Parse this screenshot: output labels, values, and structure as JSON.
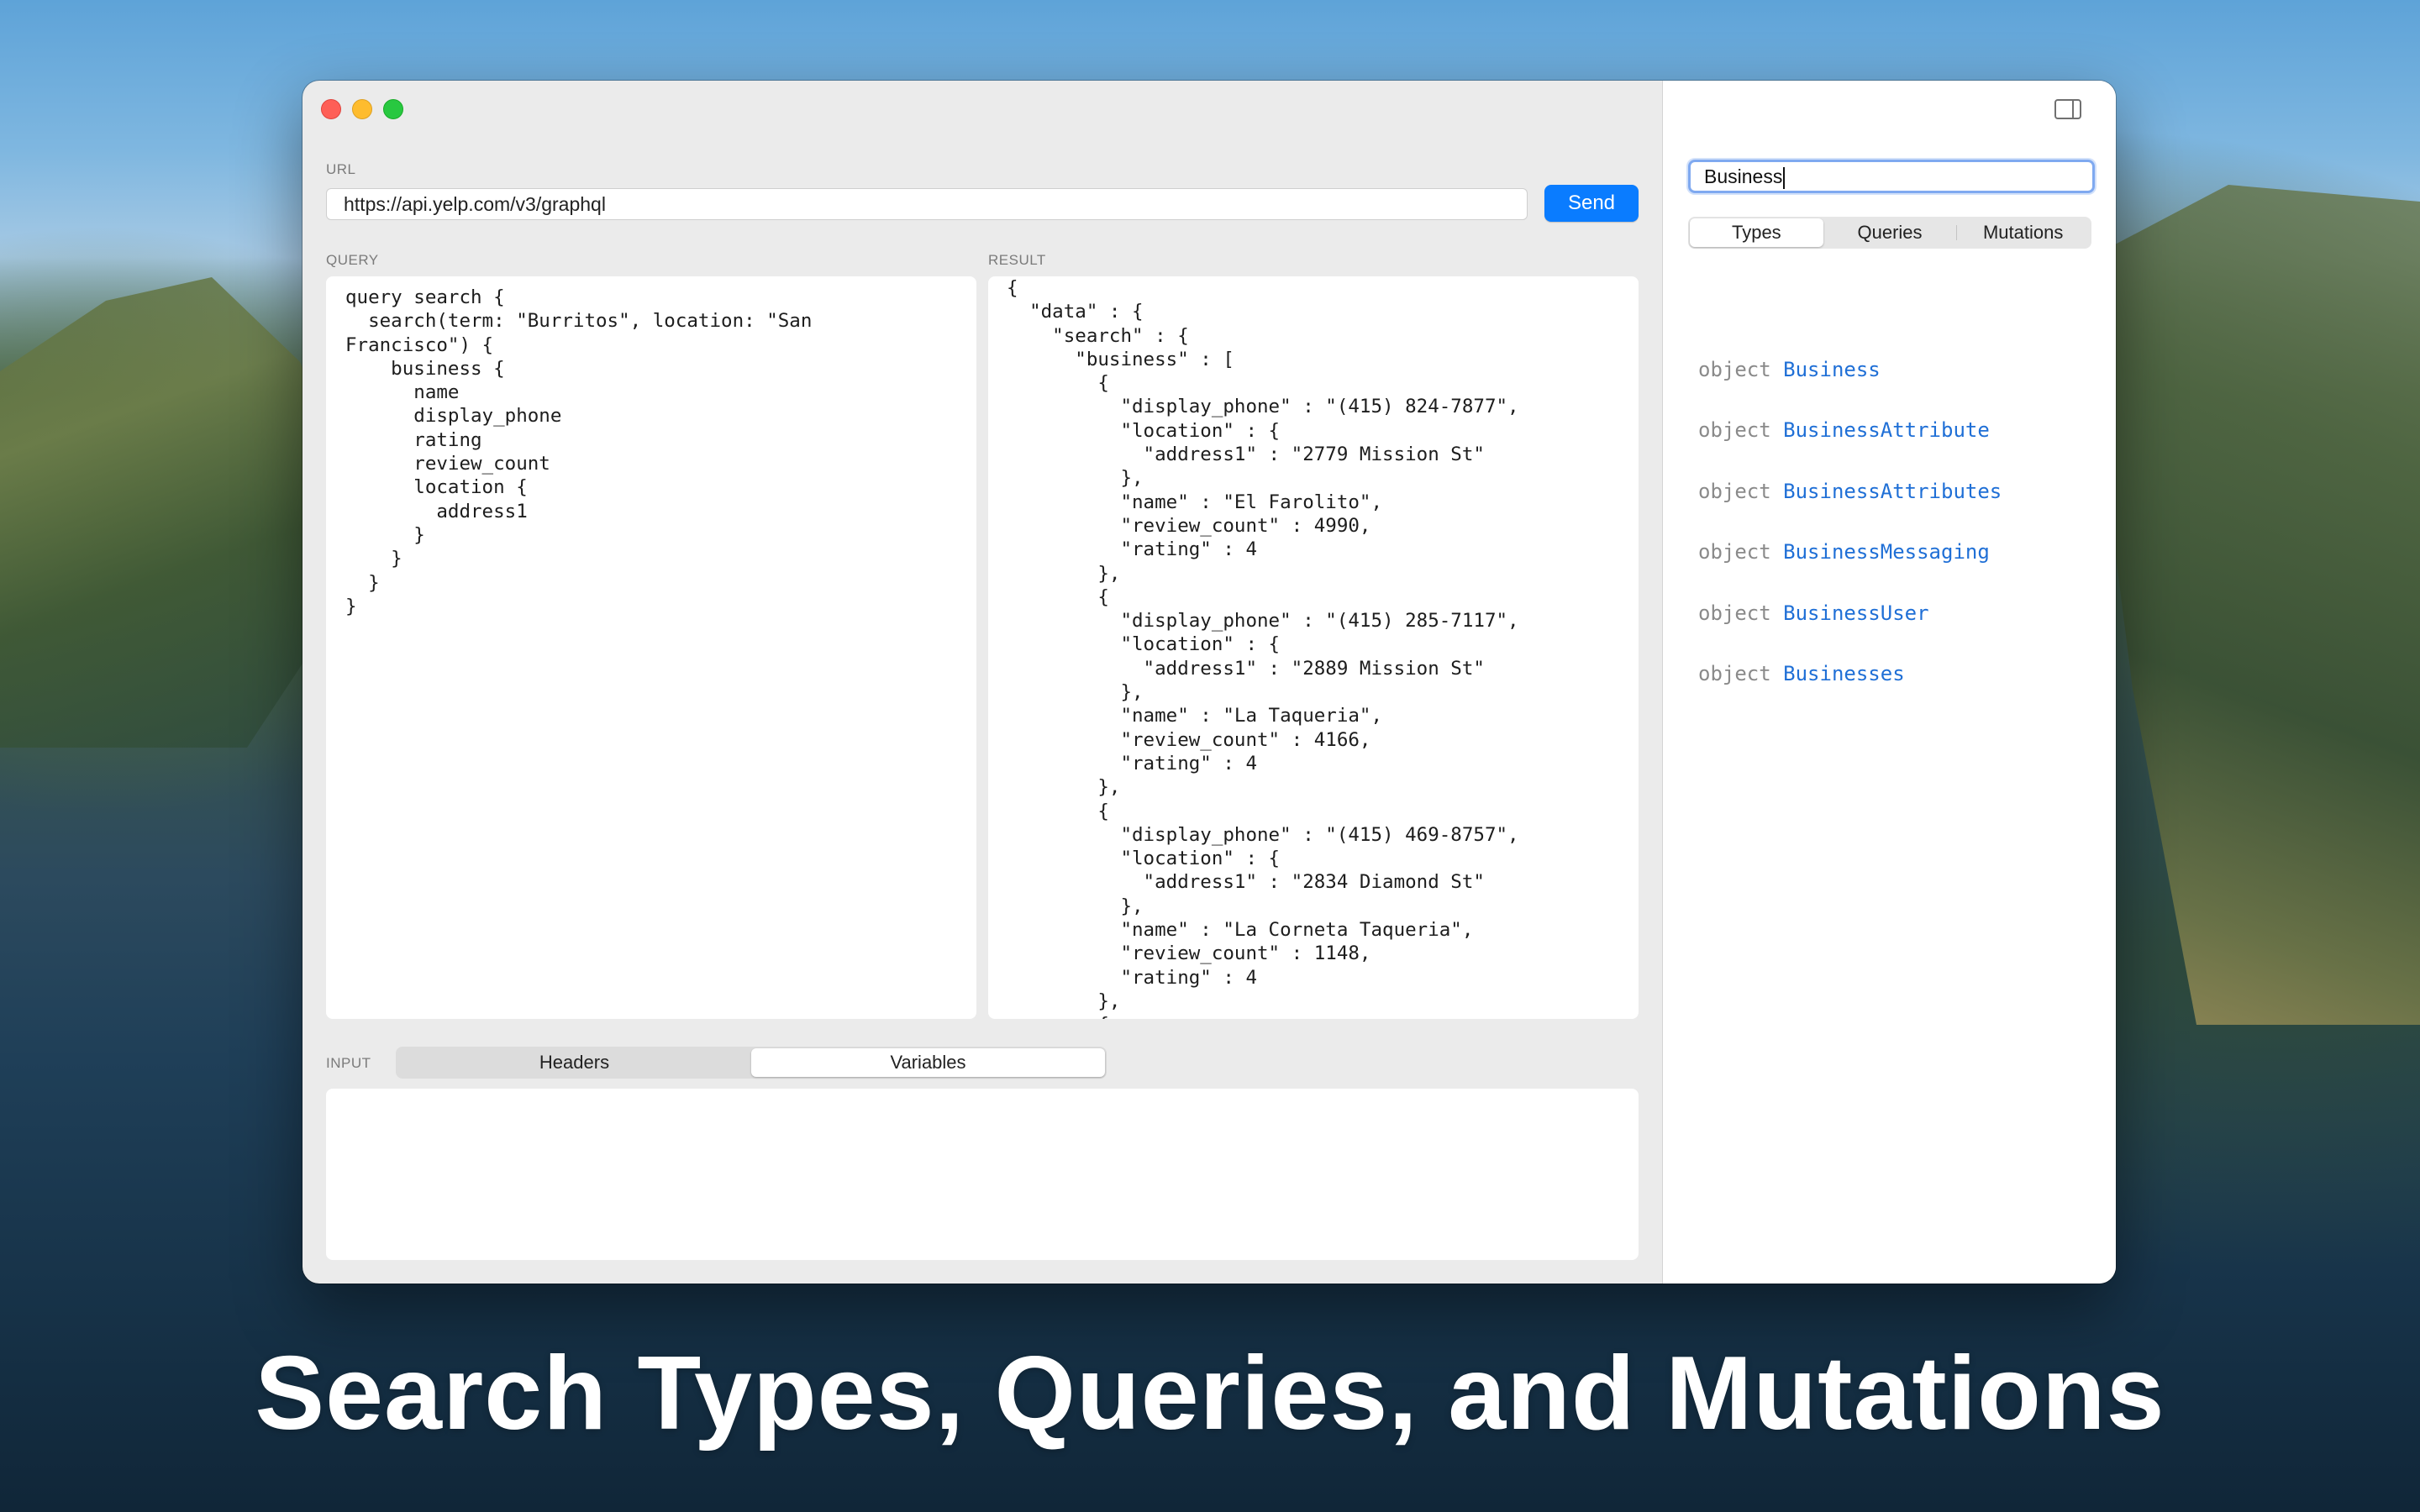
{
  "window": {
    "url_section_label": "URL",
    "url_value": "https://api.yelp.com/v3/graphql",
    "send_label": "Send",
    "query_label": "QUERY",
    "result_label": "RESULT",
    "input_label": "INPUT",
    "input_tabs": [
      {
        "label": "Headers",
        "active": false
      },
      {
        "label": "Variables",
        "active": true
      }
    ],
    "query_text": "query search {\n  search(term: \"Burritos\", location: \"San\nFrancisco\") {\n    business {\n      name\n      display_phone\n      rating\n      review_count\n      location {\n        address1\n      }\n    }\n  }\n}",
    "result_text": "{\n  \"data\" : {\n    \"search\" : {\n      \"business\" : [\n        {\n          \"display_phone\" : \"(415) 824-7877\",\n          \"location\" : {\n            \"address1\" : \"2779 Mission St\"\n          },\n          \"name\" : \"El Farolito\",\n          \"review_count\" : 4990,\n          \"rating\" : 4\n        },\n        {\n          \"display_phone\" : \"(415) 285-7117\",\n          \"location\" : {\n            \"address1\" : \"2889 Mission St\"\n          },\n          \"name\" : \"La Taqueria\",\n          \"review_count\" : 4166,\n          \"rating\" : 4\n        },\n        {\n          \"display_phone\" : \"(415) 469-8757\",\n          \"location\" : {\n            \"address1\" : \"2834 Diamond St\"\n          },\n          \"name\" : \"La Corneta Taqueria\",\n          \"review_count\" : 1148,\n          \"rating\" : 4\n        },\n        {"
  },
  "sidebar": {
    "search_value": "Business",
    "tabs": [
      {
        "label": "Types",
        "active": true
      },
      {
        "label": "Queries",
        "active": false
      },
      {
        "label": "Mutations",
        "active": false
      }
    ],
    "results": [
      {
        "kind": "object",
        "name": "Business"
      },
      {
        "kind": "object",
        "name": "BusinessAttribute"
      },
      {
        "kind": "object",
        "name": "BusinessAttributes"
      },
      {
        "kind": "object",
        "name": "BusinessMessaging"
      },
      {
        "kind": "object",
        "name": "BusinessUser"
      },
      {
        "kind": "object",
        "name": "Businesses"
      }
    ]
  },
  "caption": "Search Types, Queries, and Mutations",
  "colors": {
    "accent": "#0a7cff",
    "type_name": "#1f6fd6",
    "close": "#fe5f57",
    "minimize": "#febc2e",
    "zoom": "#28c840"
  }
}
